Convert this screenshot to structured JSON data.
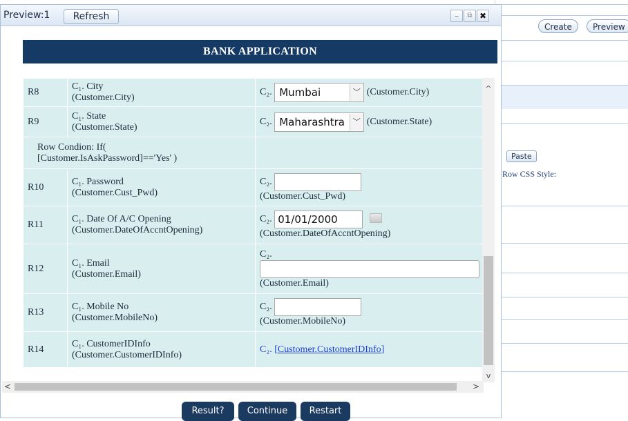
{
  "background": {
    "create_label": "Create",
    "preview_label": "Preview",
    "paste_label": "Paste",
    "row_css_label": "Row CSS Style:"
  },
  "window": {
    "title": "Preview:1",
    "refresh_label": "Refresh",
    "minimize_icon": "minimize-icon",
    "popout_icon": "popout-icon",
    "close_icon": "close-icon"
  },
  "banner": "BANK APPLICATION",
  "rows": [
    {
      "num": "R8",
      "c1_label": "C₁. City",
      "c1_field": "(Customer.City)",
      "c2_prefix": "C₂.",
      "c2_value": "Mumbai",
      "c2_field": "(Customer.City)"
    },
    {
      "num": "R9",
      "c1_label": "C₁. State",
      "c1_field": "(Customer.State)",
      "c2_prefix": "C₂.",
      "c2_value": "Maharashtra",
      "c2_field": "(Customer.State)"
    },
    {
      "condition_line1": "Row Condion: If(",
      "condition_line2": "[Customer.IsAskPassword]=='Yes' )"
    },
    {
      "num": "R10",
      "c1_label": "C₁. Password",
      "c1_field": "(Customer.Cust_Pwd)",
      "c2_prefix": "C₂.",
      "c2_value": "",
      "c2_field": "(Customer.Cust_Pwd)"
    },
    {
      "num": "R11",
      "c1_label": "C₁. Date Of A/C Opening",
      "c1_field": "(Customer.DateOfAccntOpening)",
      "c2_prefix": "C₂.",
      "c2_value": "01/01/2000",
      "c2_field": "(Customer.DateOfAccntOpening)"
    },
    {
      "num": "R12",
      "c1_label": "C₁. Email",
      "c1_field": "(Customer.Email)",
      "c2_prefix": "C₂.",
      "c2_value": "",
      "c2_field": "(Customer.Email)"
    },
    {
      "num": "R13",
      "c1_label": "C₁. Mobile No",
      "c1_field": "(Customer.MobileNo)",
      "c2_prefix": "C₂.",
      "c2_value": "",
      "c2_field": "(Customer.MobileNo)"
    },
    {
      "num": "R14",
      "c1_label": "C₁. CustomerIDInfo",
      "c1_field": "(Customer.CustomerIDInfo)",
      "c2_prefix": "C₂.",
      "c2_link": "[Customer.CustomerIDInfo]"
    }
  ],
  "actions": {
    "result_label": "Result?",
    "continue_label": "Continue",
    "restart_label": "Restart"
  },
  "colors": {
    "banner_bg": "#153a63",
    "row_bg": "#d9efef",
    "button_bg": "#1b3a5f",
    "link": "#1d3fd1"
  }
}
